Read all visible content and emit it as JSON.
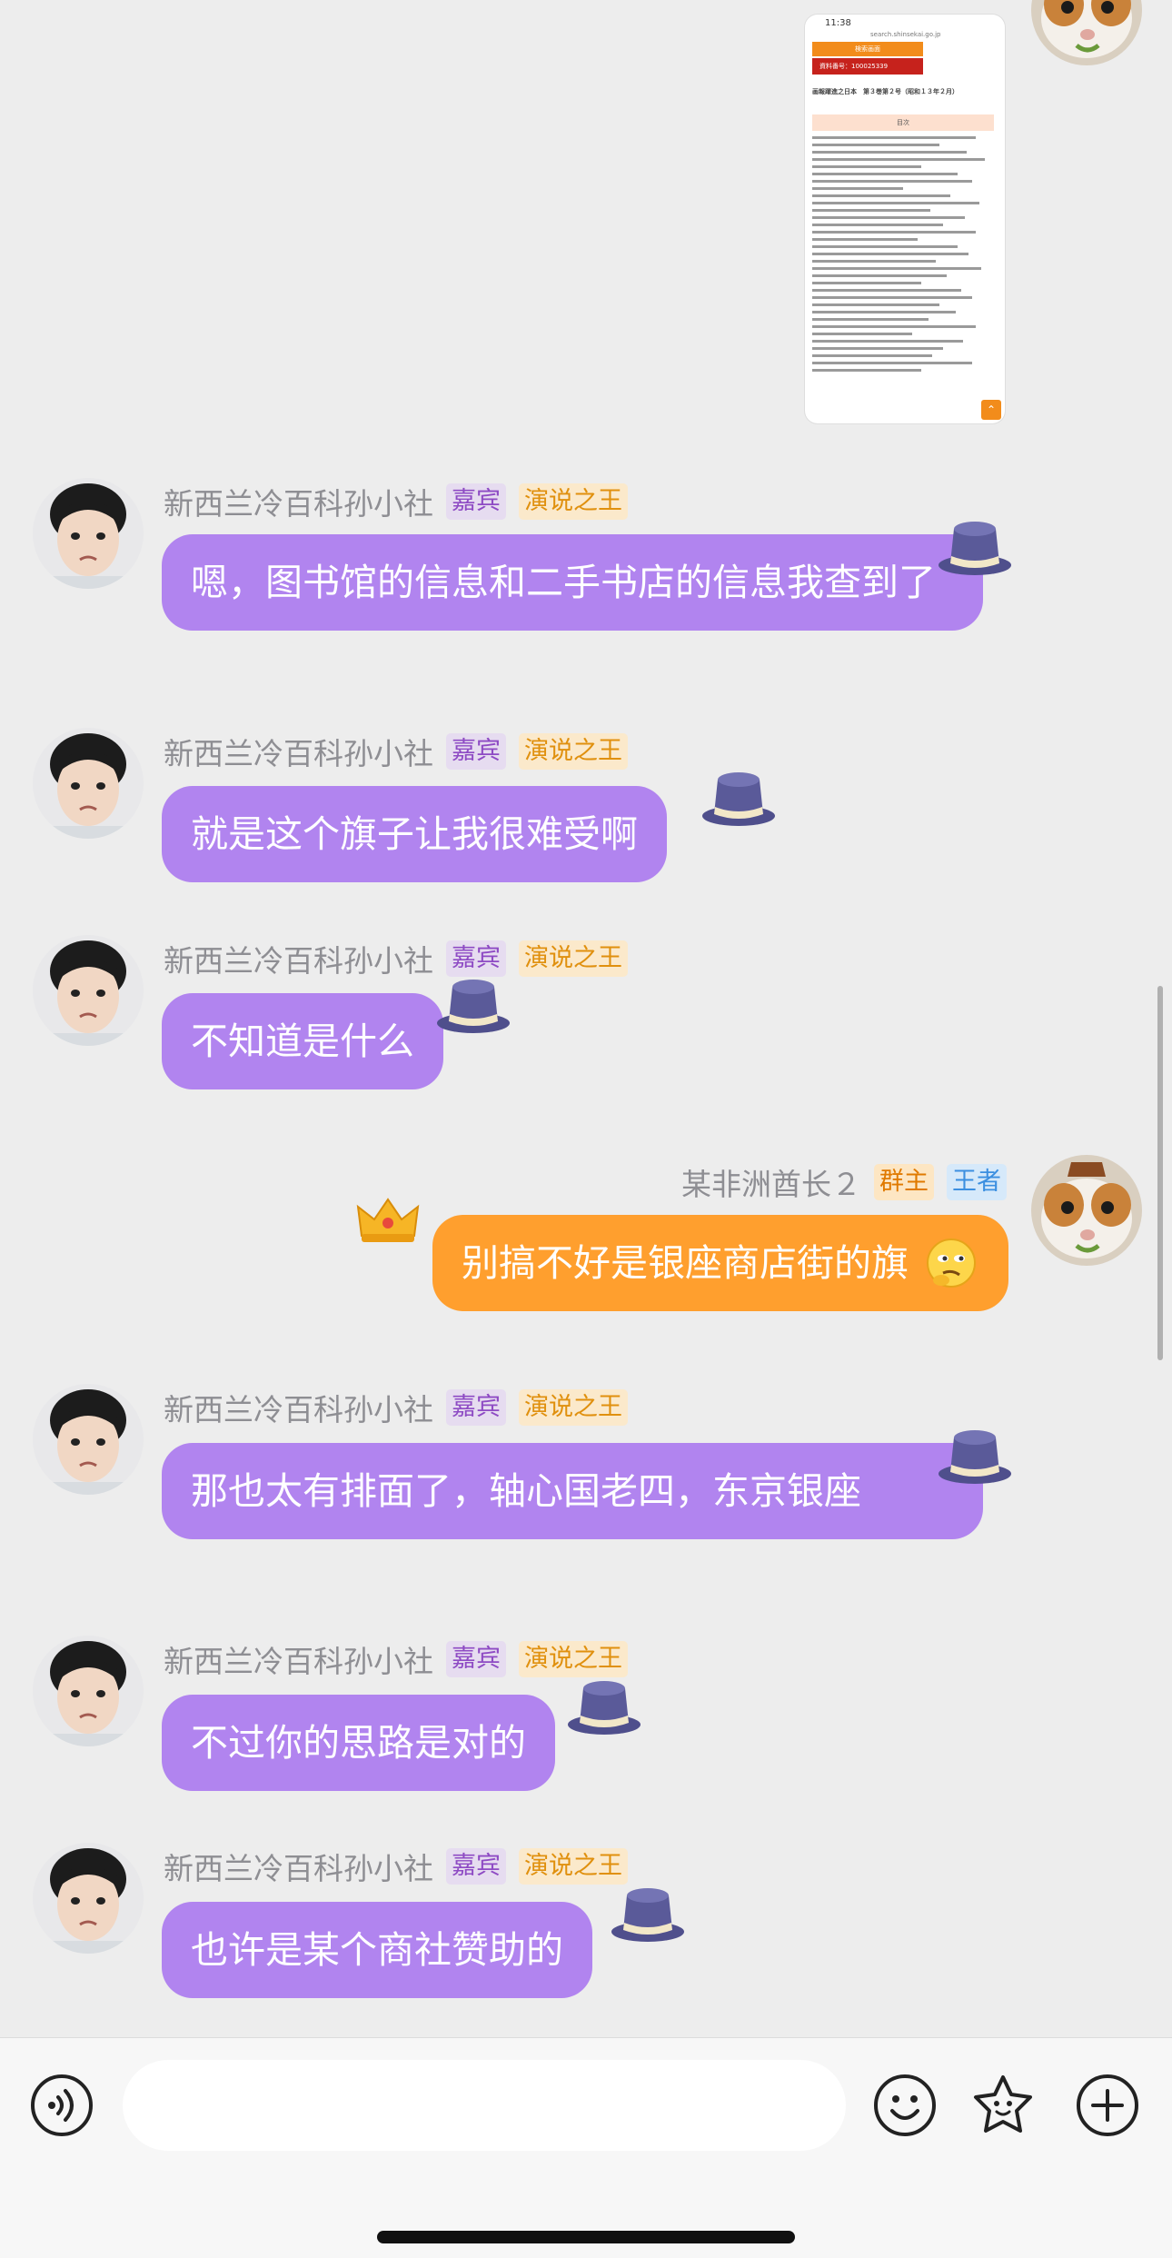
{
  "colors": {
    "background": "#ededed",
    "bubble_purple": "#b184ef",
    "bubble_orange": "#ff9f2e",
    "badge_guest": "#8e4bc4",
    "badge_speech": "#e0900e",
    "badge_owner": "#e07a00",
    "badge_king": "#3c8fe0"
  },
  "image_message": {
    "doc_time": "11:38",
    "doc_url": "search.shinsekai.go.jp",
    "doc_button": "検索画面",
    "doc_record": "資料番号：100025339",
    "doc_title": "画報躍進之日本　第３巻第２号（昭和１３年２月）",
    "doc_band": "目次"
  },
  "messages": [
    {
      "nickname": "新西兰冷百科孙小社",
      "badges": [
        "嘉宾",
        "演说之王"
      ],
      "text": "嗯，图书馆的信息和二手书店的信息我查到了"
    },
    {
      "nickname": "新西兰冷百科孙小社",
      "badges": [
        "嘉宾",
        "演说之王"
      ],
      "text": "就是这个旗子让我很难受啊"
    },
    {
      "nickname": "新西兰冷百科孙小社",
      "badges": [
        "嘉宾",
        "演说之王"
      ],
      "text": "不知道是什么"
    },
    {
      "nickname": "某非洲酋长２",
      "badges": [
        "群主",
        "王者"
      ],
      "text": "别搞不好是银座商店街的旗",
      "emoji": "thinking-emoji"
    },
    {
      "nickname": "新西兰冷百科孙小社",
      "badges": [
        "嘉宾",
        "演说之王"
      ],
      "text": "那也太有排面了，轴心国老四，东京银座"
    },
    {
      "nickname": "新西兰冷百科孙小社",
      "badges": [
        "嘉宾",
        "演说之王"
      ],
      "text": "不过你的思路是对的"
    },
    {
      "nickname": "新西兰冷百科孙小社",
      "badges": [
        "嘉宾",
        "演说之王"
      ],
      "text": "也许是某个商社赞助的"
    }
  ],
  "input": {
    "value": "",
    "placeholder": ""
  },
  "icons": {
    "voice": "voice-icon",
    "emoji": "smiley-icon",
    "sticker": "sticker-icon",
    "plus": "plus-icon"
  }
}
